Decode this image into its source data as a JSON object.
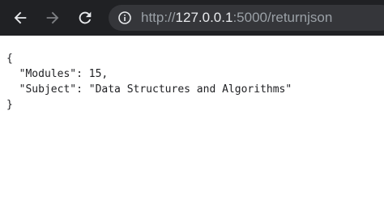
{
  "browser": {
    "url_scheme": "http://",
    "url_host": "127.0.0.1",
    "url_rest": ":5000/returnjson",
    "icons": {
      "back": "arrow-left-icon",
      "forward": "arrow-right-icon",
      "reload": "reload-icon",
      "site_info": "info-circle-icon"
    },
    "colors": {
      "toolbar_bg": "#202124",
      "omnibox_bg": "#35363a",
      "url_dim": "#9aa0a6",
      "url_host": "#e8eaed"
    }
  },
  "page": {
    "json_lines": [
      "{",
      "  \"Modules\": 15,",
      "  \"Subject\": \"Data Structures and Algorithms\"",
      "}"
    ]
  }
}
